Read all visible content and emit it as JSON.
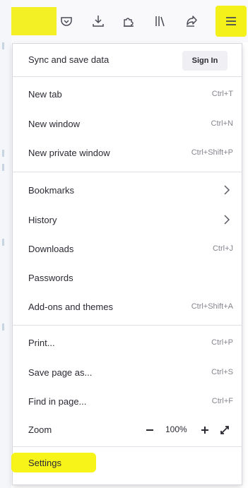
{
  "colors": {
    "highlight": "#f2f000",
    "text": "#2b2a33",
    "shortcut": "#86858f"
  },
  "toolbar": {
    "icons": [
      "pocket-icon",
      "download-icon",
      "extensions-puzzle-icon",
      "library-icon",
      "share-icon",
      "hamburger-menu-icon"
    ]
  },
  "menu": {
    "sync_label": "Sync and save data",
    "sign_in": "Sign In",
    "new_tab": {
      "label": "New tab",
      "shortcut": "Ctrl+T"
    },
    "new_window": {
      "label": "New window",
      "shortcut": "Ctrl+N"
    },
    "new_private_window": {
      "label": "New private window",
      "shortcut": "Ctrl+Shift+P"
    },
    "bookmarks": {
      "label": "Bookmarks"
    },
    "history": {
      "label": "History"
    },
    "downloads": {
      "label": "Downloads",
      "shortcut": "Ctrl+J"
    },
    "passwords": {
      "label": "Passwords"
    },
    "addons": {
      "label": "Add-ons and themes",
      "shortcut": "Ctrl+Shift+A"
    },
    "print": {
      "label": "Print...",
      "shortcut": "Ctrl+P"
    },
    "save_page": {
      "label": "Save page as...",
      "shortcut": "Ctrl+S"
    },
    "find_in_page": {
      "label": "Find in page...",
      "shortcut": "Ctrl+F"
    },
    "zoom": {
      "label": "Zoom",
      "level": "100%"
    },
    "settings": {
      "label": "Settings"
    }
  }
}
